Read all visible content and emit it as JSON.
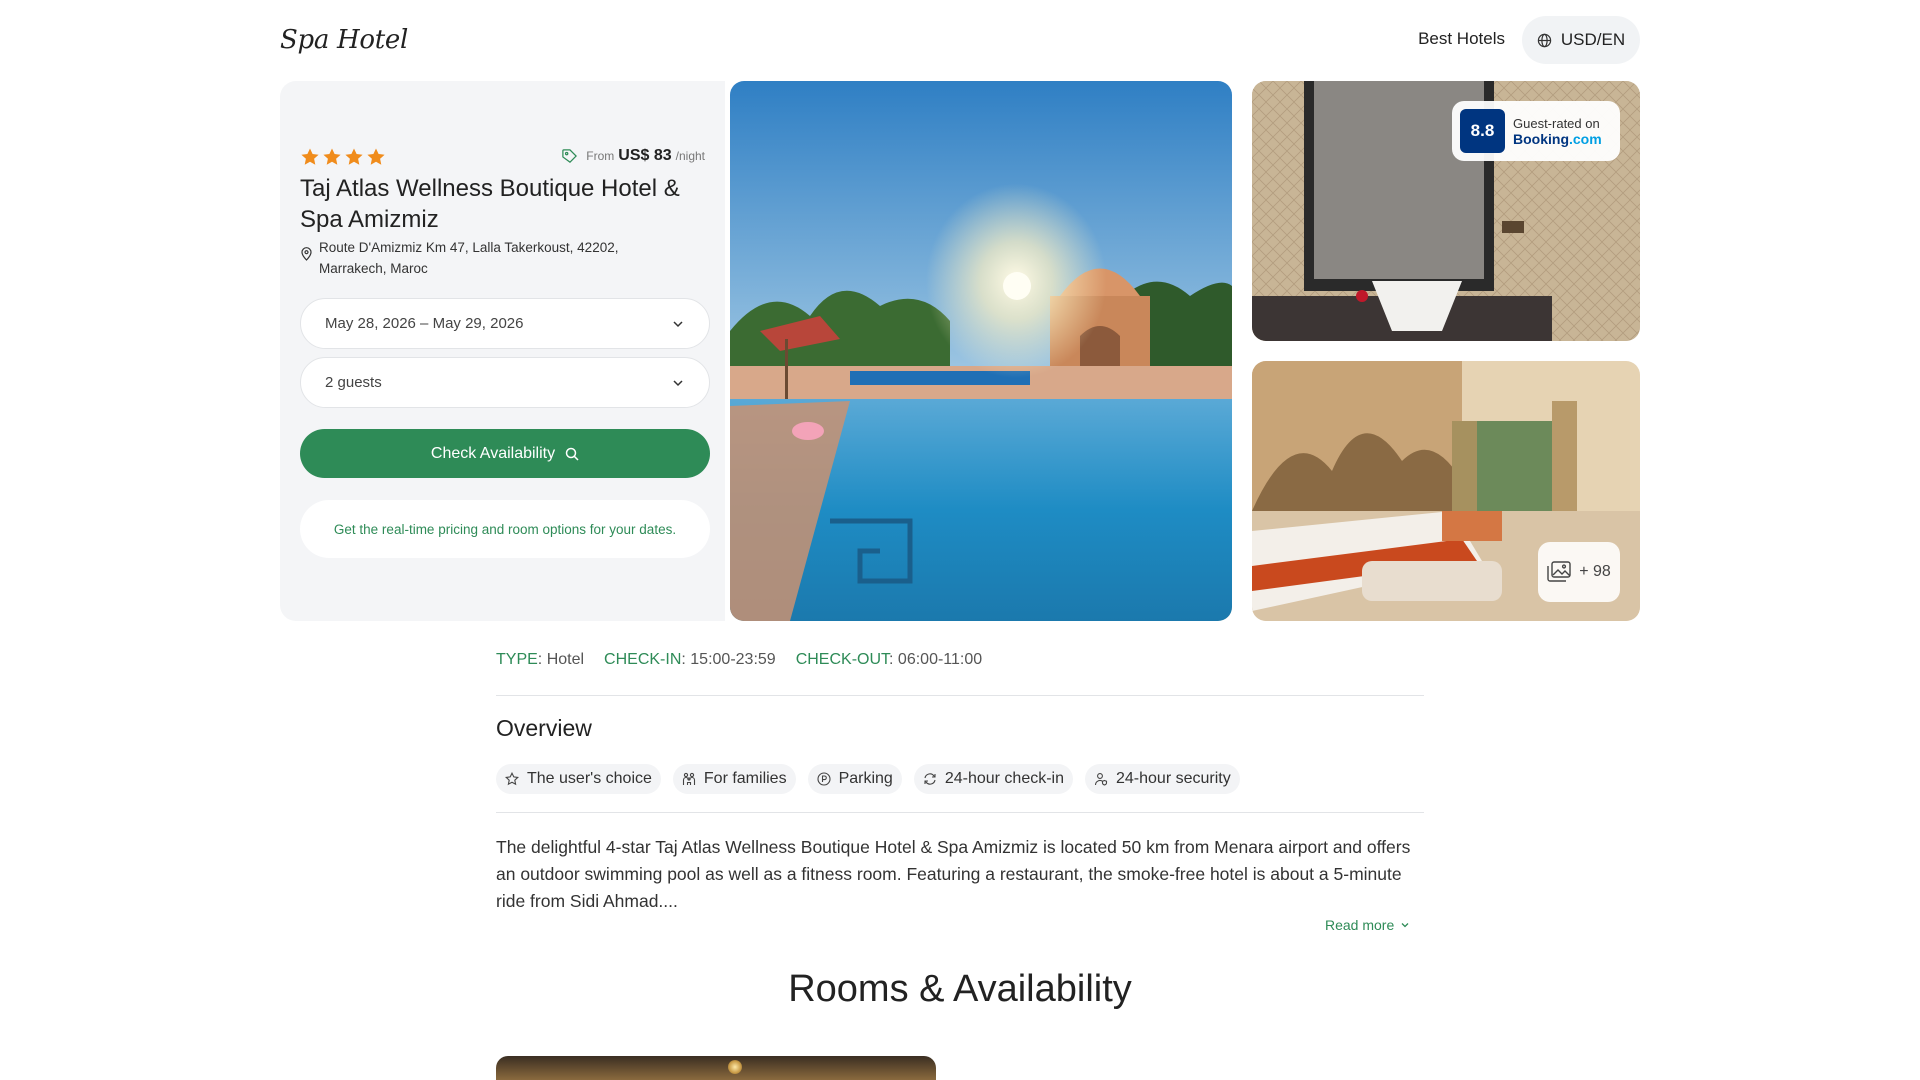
{
  "header": {
    "logo": "Spa Hotel",
    "nav_link": "Best Hotels",
    "currency_label": "USD/EN"
  },
  "booking": {
    "stars": 4,
    "price_prefix": "From",
    "price_amount": "US$ 83",
    "price_suffix": "/night",
    "hotel_name": "Taj Atlas Wellness Boutique Hotel & Spa Amizmiz",
    "address_line1": "Route D'Amizmiz Km 47, Lalla Takerkoust, 42202,",
    "address_line2": "Marrakech, Maroc",
    "dates_value": "May 28, 2026 – May 29, 2026",
    "guests_value": "2 guests",
    "check_button": "Check Availability",
    "info_text": "Get the real-time pricing and room options for your dates."
  },
  "rating": {
    "score": "8.8",
    "rated_on": "Guest-rated on",
    "brand_main": "Booking",
    "brand_suffix": ".com"
  },
  "gallery": {
    "more_count": "+ 98"
  },
  "meta": {
    "type_label": "TYPE",
    "type_value": "Hotel",
    "checkin_label": "CHECK-IN",
    "checkin_value": "15:00-23:59",
    "checkout_label": "CHECK-OUT",
    "checkout_value": "06:00-11:00"
  },
  "overview": {
    "title": "Overview",
    "chips": [
      {
        "label": "The user's choice",
        "icon": "star-outline-icon"
      },
      {
        "label": "For families",
        "icon": "family-icon"
      },
      {
        "label": "Parking",
        "icon": "parking-icon"
      },
      {
        "label": "24-hour check-in",
        "icon": "refresh-icon"
      },
      {
        "label": "24-hour security",
        "icon": "security-icon"
      }
    ],
    "description": "The delightful 4-star Taj Atlas Wellness Boutique Hotel & Spa Amizmiz is located 50 km from Menara airport and offers an outdoor swimming pool as well as a fitness room. Featuring a restaurant, the smoke-free hotel is about a 5-minute ride from Sidi Ahmad....",
    "read_more": "Read more"
  },
  "rooms": {
    "title": "Rooms & Availability"
  },
  "colors": {
    "accent_green": "#2e8b57",
    "star_orange": "#f08c1c",
    "booking_blue": "#003580"
  }
}
